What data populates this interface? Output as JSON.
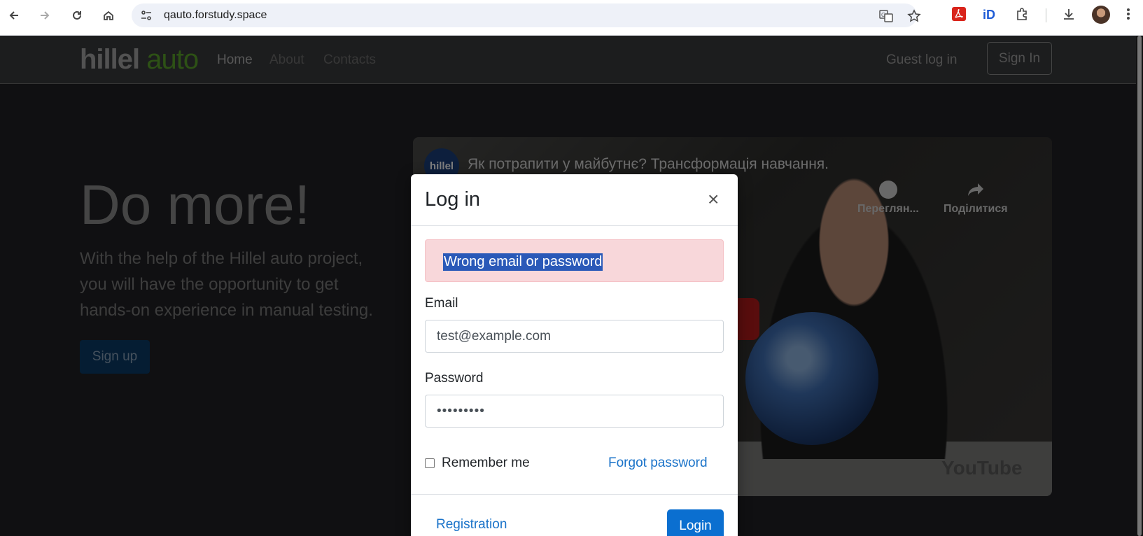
{
  "browser": {
    "url": "qauto.forstudy.space",
    "icons": [
      "back-icon",
      "forward-icon",
      "reload-icon",
      "home-icon",
      "site-settings-icon",
      "translate-icon",
      "bookmark-star-icon",
      "pdf-extension-icon",
      "id-extension-icon",
      "extensions-puzzle-icon",
      "download-icon",
      "profile-avatar",
      "menu-kebab-icon"
    ]
  },
  "header": {
    "logo_part1": "hillel",
    "logo_part2": "auto",
    "nav": [
      {
        "label": "Home",
        "active": true
      },
      {
        "label": "About",
        "active": false
      },
      {
        "label": "Contacts",
        "active": false
      }
    ],
    "guest_login": "Guest log in",
    "sign_in": "Sign In"
  },
  "hero": {
    "title": "Do more!",
    "text": "With the help of the Hillel auto project, you will have the opportunity to get hands-on experience in manual testing.",
    "signup": "Sign up"
  },
  "video": {
    "channel": "hillel",
    "title": "Як потрапити у майбутнє? Трансформація навчання.",
    "watch_later": "Переглян...",
    "share": "Поділитися",
    "youtube": "YouTube"
  },
  "modal": {
    "title": "Log in",
    "close": "×",
    "error": "Wrong email or password",
    "email_label": "Email",
    "email_value": "test@example.com",
    "password_label": "Password",
    "password_value": "•••••••••",
    "remember_me": "Remember me",
    "forgot_password": "Forgot password",
    "registration": "Registration",
    "login": "Login"
  },
  "colors": {
    "accent": "#0b6fd0",
    "alert_bg": "#f8d7da",
    "logo_green": "#5aa22a"
  }
}
